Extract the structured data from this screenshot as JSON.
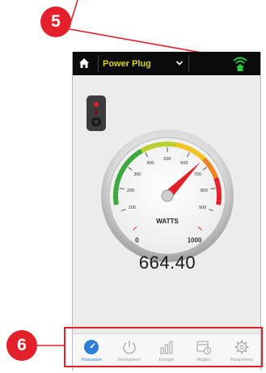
{
  "callouts": {
    "top": "5",
    "bottom": "6"
  },
  "topbar": {
    "device_name": "Power Plug"
  },
  "gauge": {
    "unit": "WATTS",
    "reading": "664.40",
    "reading_value": 664.4,
    "min": 0,
    "max": 1000,
    "ticks": [
      "0",
      "100",
      "200",
      "300",
      "400",
      "500",
      "600",
      "700",
      "800",
      "900",
      "1000"
    ]
  },
  "tabs": [
    {
      "label": "Puissance",
      "icon": "gauge-icon",
      "active": true
    },
    {
      "label": "Interrupteur",
      "icon": "power-icon",
      "active": false
    },
    {
      "label": "Energie",
      "icon": "bar-chart-icon",
      "active": false
    },
    {
      "label": "Règles",
      "icon": "calendar-rules-icon",
      "active": false
    },
    {
      "label": "Paramètres",
      "icon": "gear-icon",
      "active": false
    }
  ],
  "colors": {
    "accent": "#e4202a",
    "tab_active": "#2b7fd8",
    "wifi": "#27c93f",
    "device_name": "#d8d224"
  }
}
